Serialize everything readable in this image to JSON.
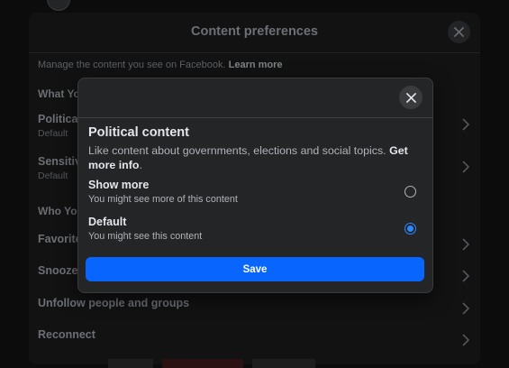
{
  "background_dialog": {
    "title": "Content preferences",
    "description": "Manage the content you see on Facebook.",
    "learn_more": "Learn more",
    "sections": {
      "what_you_see": "What Yo",
      "who_you_see": "Who Yo"
    },
    "rows": {
      "political": {
        "title": "Politica",
        "subtitle": "Default"
      },
      "sensitive": {
        "title": "Sensitiv",
        "subtitle": "Default"
      },
      "favorites": {
        "title": "Favorite"
      },
      "snooze": {
        "title": "Snooze"
      },
      "unfollow": {
        "title": "Unfollow people and groups"
      },
      "reconnect": {
        "title": "Reconnect"
      }
    }
  },
  "modal": {
    "title": "Political content",
    "description": "Like content about governments, elections and social topics.",
    "get_more_info": "Get more info",
    "description_end": ".",
    "options": [
      {
        "label": "Show more",
        "sublabel": "You might see more of this content",
        "checked": false
      },
      {
        "label": "Default",
        "sublabel": "You might see this content",
        "checked": true
      }
    ],
    "save_label": "Save"
  },
  "colors": {
    "accent": "#0866ff",
    "radio_selected": "#2d88ff",
    "modal_bg": "#242526"
  }
}
